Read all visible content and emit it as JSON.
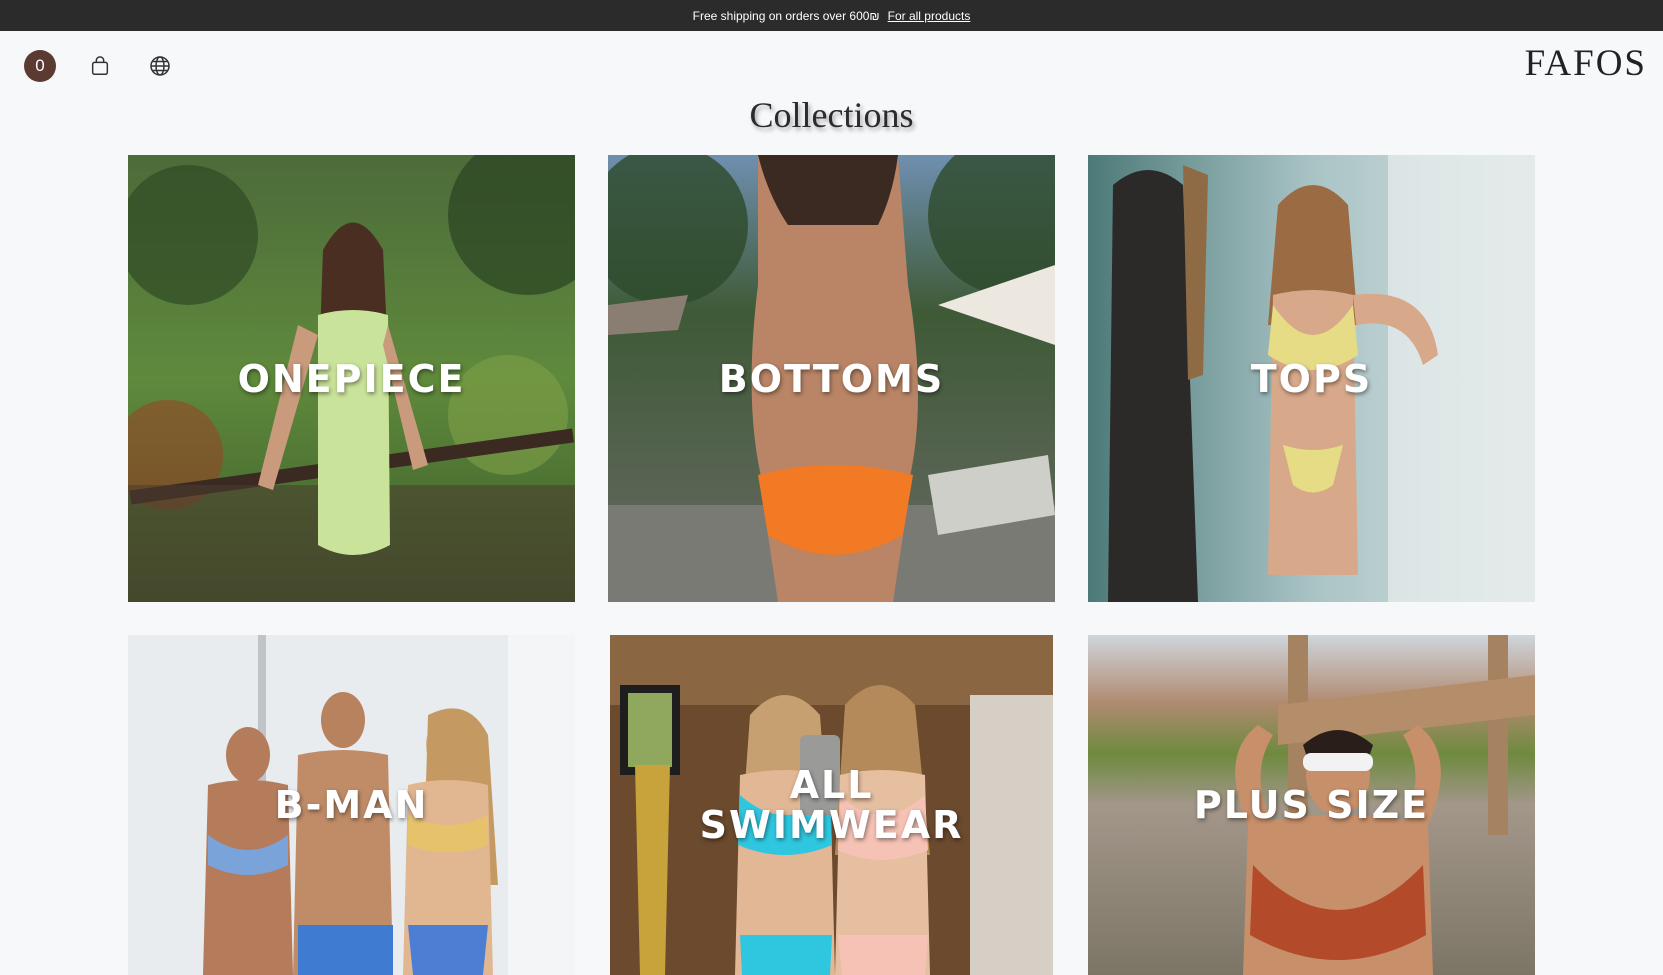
{
  "announcement": {
    "text": "Free shipping on orders over 600₪",
    "link_label": "For all products"
  },
  "header": {
    "cart_count": "0",
    "logo": "FAFOS",
    "icons": [
      "cart-count-badge",
      "shopping-bag-icon",
      "globe-icon"
    ]
  },
  "page": {
    "title": "Collections"
  },
  "collections": [
    {
      "label": "ONEPIECE"
    },
    {
      "label": "BOTTOMS"
    },
    {
      "label": "TOPS"
    },
    {
      "label": "B-MAN"
    },
    {
      "label": "ALL\nSWIMWEAR"
    },
    {
      "label": "PLUS SIZE"
    }
  ],
  "colors": {
    "announcement_bg": "#2b2b2b",
    "cart_badge": "#5b3a32",
    "page_bg": "#f7f8fa"
  }
}
